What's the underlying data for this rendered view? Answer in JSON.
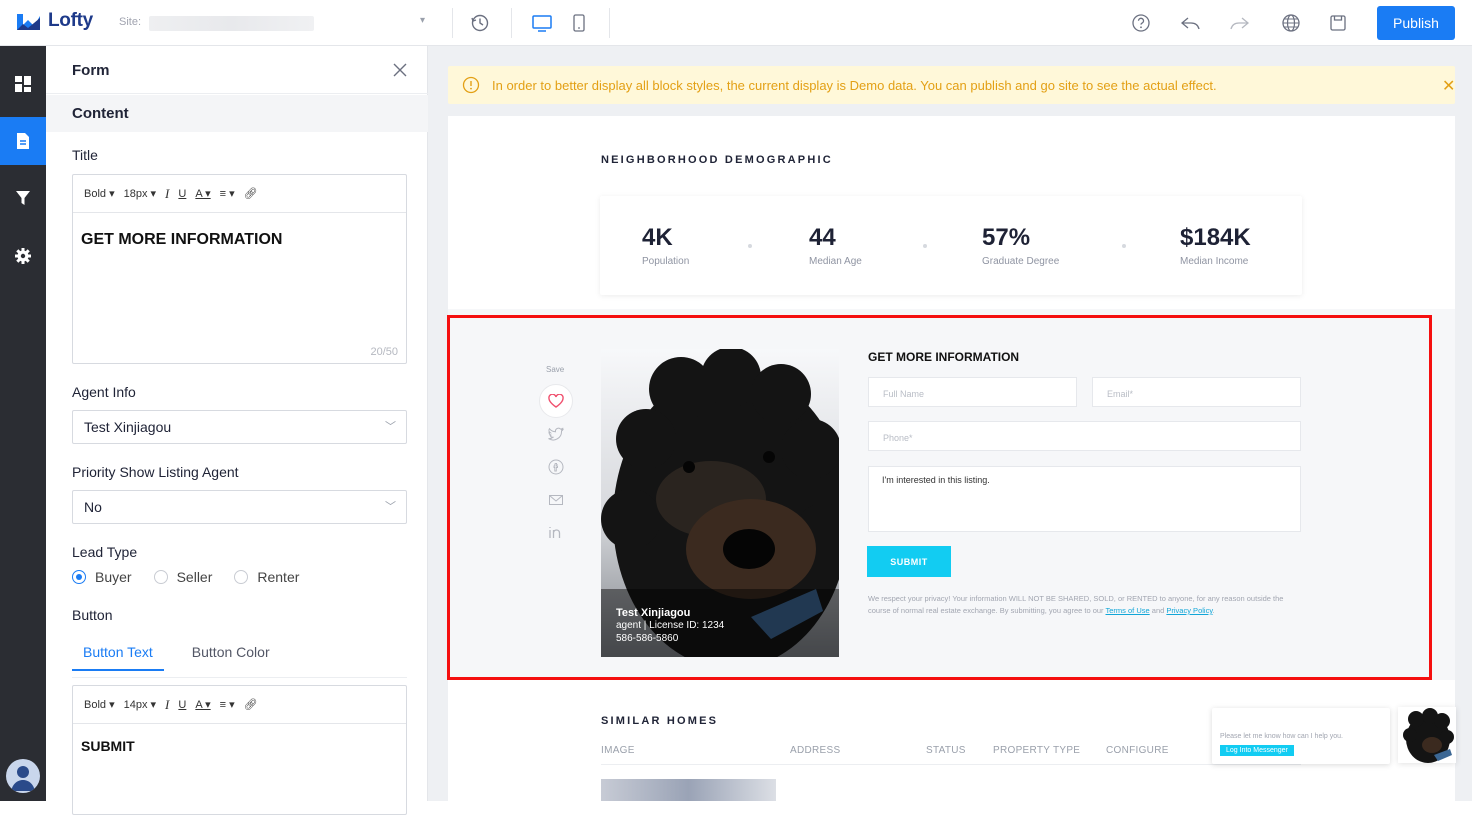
{
  "topbar": {
    "brand": "Lofty",
    "site_label": "Site:",
    "publish_label": "Publish",
    "icons": [
      "history-icon",
      "desktop-icon",
      "mobile-icon",
      "help-icon",
      "undo-icon",
      "redo-icon",
      "globe-icon",
      "save-icon"
    ]
  },
  "nav": {
    "items": [
      "grid-icon",
      "page-icon",
      "filter-icon",
      "settings-icon"
    ],
    "active": "page-icon"
  },
  "panel": {
    "title": "Form",
    "section": "Content",
    "title_label": "Title",
    "editor1": {
      "weight": "Bold",
      "size": "18px",
      "value": "GET MORE INFORMATION",
      "count": "20/50"
    },
    "agent_info_label": "Agent Info",
    "agent_info_value": "Test Xinjiagou",
    "priority_label": "Priority Show Listing Agent",
    "priority_value": "No",
    "lead_type_label": "Lead Type",
    "lead_types": [
      "Buyer",
      "Seller",
      "Renter"
    ],
    "lead_type_selected": "Buyer",
    "button_label": "Button",
    "tabs": [
      "Button Text",
      "Button Color"
    ],
    "tab_active": "Button Text",
    "editor2": {
      "weight": "Bold",
      "size": "14px",
      "value": "SUBMIT"
    }
  },
  "notice": {
    "text": "In order to better display all block styles, the current display is Demo data. You can publish and go site to see the actual effect."
  },
  "demographic": {
    "title": "NEIGHBORHOOD DEMOGRAPHIC",
    "stats": [
      {
        "value": "4K",
        "label": "Population"
      },
      {
        "value": "44",
        "label": "Median Age"
      },
      {
        "value": "57%",
        "label": "Graduate Degree"
      },
      {
        "value": "$184K",
        "label": "Median Income"
      }
    ]
  },
  "form_block": {
    "save_label": "Save",
    "share_icons": [
      "heart-icon",
      "twitter-icon",
      "facebook-icon",
      "mail-icon",
      "linkedin-icon"
    ],
    "agent_name": "Test Xinjiagou",
    "agent_license": "agent | License ID: 1234",
    "agent_phone": "586-586-5860",
    "title": "GET MORE INFORMATION",
    "placeholders": {
      "full_name": "Full Name",
      "email": "Email*",
      "phone": "Phone*"
    },
    "message": "I'm interested in this listing.",
    "submit": "SUBMIT",
    "privacy_text": "We respect your privacy! Your information WILL NOT BE SHARED, SOLD, or RENTED to anyone, for any reason outside the course of normal real estate exchange. By submitting, you agree to our",
    "terms_link": "Terms of Use",
    "and_text": "and",
    "privacy_link": "Privacy Policy",
    "period": "."
  },
  "similar": {
    "title": "SIMILAR HOMES",
    "columns": [
      "IMAGE",
      "ADDRESS",
      "STATUS",
      "PROPERTY TYPE",
      "CONFIGURE"
    ]
  },
  "chat": {
    "text": "Please let me know how can I help you.",
    "button": "Log Into Messenger"
  },
  "colors": {
    "accent": "#1a7cf4",
    "cyan": "#12ccf2",
    "highlight": "#f50f0f",
    "notice": "#e3a015"
  }
}
